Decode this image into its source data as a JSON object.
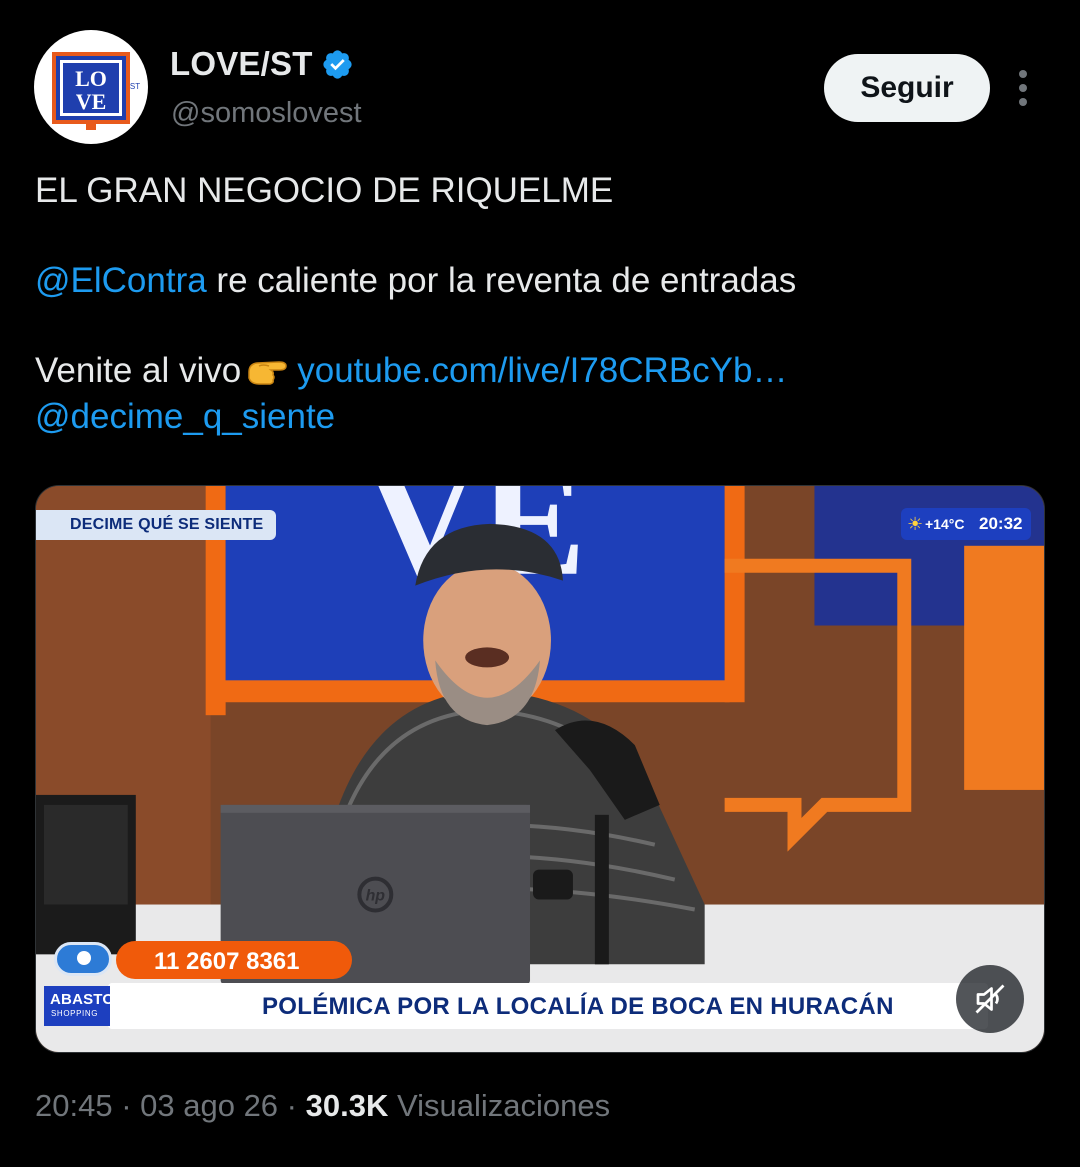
{
  "author": {
    "avatar_text_top": "LO",
    "avatar_text_bottom": "VE",
    "avatar_superscript": "ST",
    "display_name": "LOVE/ST",
    "handle": "@somoslovest",
    "verified_icon": "verified-badge-icon",
    "verified_color": "#1d9bf0"
  },
  "actions": {
    "follow_label": "Seguir",
    "more_icon": "more-options-icon"
  },
  "tweet": {
    "line1": "EL GRAN NEGOCIO DE RIQUELME",
    "mention1": "@ElContra",
    "line2_rest": " re caliente por la reventa de entradas",
    "line3_prefix": "Venite al vivo",
    "emoji_icon": "pointing-right-hand-icon",
    "link": "youtube.com/live/I78CRBcYb…",
    "mention2": "@decime_q_siente"
  },
  "media": {
    "show_banner": "DECIME QUÉ SE SIENTE",
    "weather_temp": "+14°C",
    "weather_time": "20:32",
    "weather_icon": "sun-cloud-icon",
    "phone": "11 2607 8361",
    "sponsor_line1": "ABASTO",
    "sponsor_line2": "SHOPPING",
    "headline": "POLÉMICA POR LA LOCALÍA DE BOCA EN HURACÁN",
    "mute_icon": "muted-speaker-icon",
    "laptop_logo": "hp",
    "wall_letters": "VE"
  },
  "meta": {
    "time": "20:45",
    "sep1": " · ",
    "date": "03 ago 26",
    "sep2": " · ",
    "views": "30.3K",
    "views_label": " Visualizaciones"
  },
  "colors": {
    "link": "#1d9bf0",
    "text": "#e7e9ea",
    "muted": "#71767b",
    "background": "#000000",
    "accent_orange": "#f05a0a",
    "accent_blue": "#1d3fbf"
  }
}
